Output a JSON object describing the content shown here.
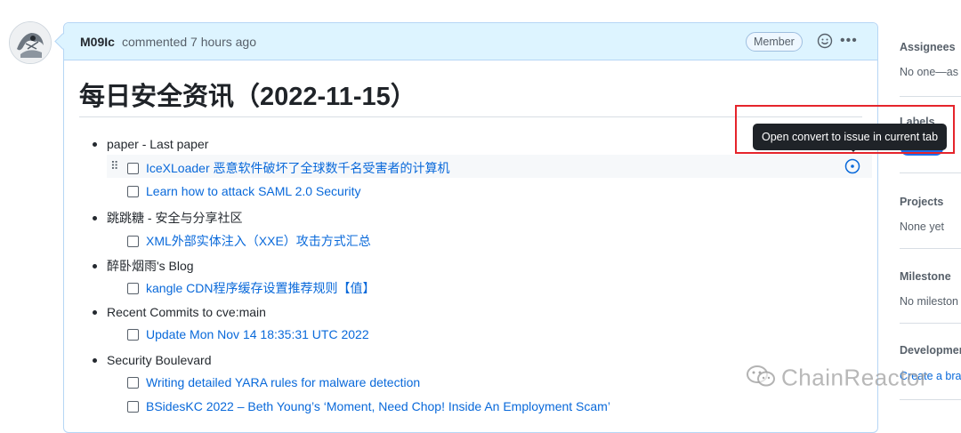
{
  "comment": {
    "author": "M09Ic",
    "meta": "commented 7 hours ago",
    "badge": "Member",
    "title": "每日安全资讯（2022-11-15）"
  },
  "sections": [
    {
      "heading": "paper - Last paper",
      "items": [
        "IceXLoader 恶意软件破坏了全球数千名受害者的计算机",
        "Learn how to attack SAML 2.0 Security"
      ]
    },
    {
      "heading": "跳跳糖 - 安全与分享社区",
      "items": [
        "XML外部实体注入（XXE）攻击方式汇总"
      ]
    },
    {
      "heading": "醉卧烟雨's Blog",
      "items": [
        "kangle CDN程序缓存设置推荐规则【值】"
      ]
    },
    {
      "heading": "Recent Commits to cve:main",
      "items": [
        "Update Mon Nov 14 18:35:31 UTC 2022"
      ]
    },
    {
      "heading": "Security Boulevard",
      "items": [
        "Writing detailed YARA rules for malware detection",
        "BSidesKC 2022 – Beth Young’s ‘Moment, Need Chop! Inside An Employment Scam’"
      ]
    }
  ],
  "tooltip": "Open convert to issue in current tab",
  "sidebar": {
    "assignees_heading": "Assignees",
    "assignees_value": "No one—as",
    "labels_heading": "Labels",
    "projects_heading": "Projects",
    "projects_value": "None yet",
    "milestone_heading": "Milestone",
    "milestone_value": "No mileston",
    "development_heading": "Developmen",
    "development_value": "Create a bra"
  },
  "watermark": "ChainReactor",
  "colors": {
    "link": "#0969da",
    "header_bg": "#ddf4ff",
    "highlight": "#e5242b",
    "label": "#1f6feb"
  }
}
